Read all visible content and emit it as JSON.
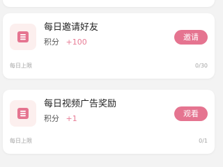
{
  "theme": {
    "accent": "#e57490",
    "icon_background": "#fcefee",
    "points_color": "#e87c95"
  },
  "tasks": [
    {
      "icon": "document-icon",
      "title": "每日邀请好友",
      "points_label": "积分",
      "points_value": "+100",
      "button_label": "邀请",
      "limit_label": "每日上限",
      "limit_count": "0/30"
    },
    {
      "icon": "document-icon",
      "title": "每日视频广告奖励",
      "points_label": "积分",
      "points_value": "+1",
      "button_label": "观看",
      "limit_label": "每日上限",
      "limit_count": "0/1"
    }
  ]
}
